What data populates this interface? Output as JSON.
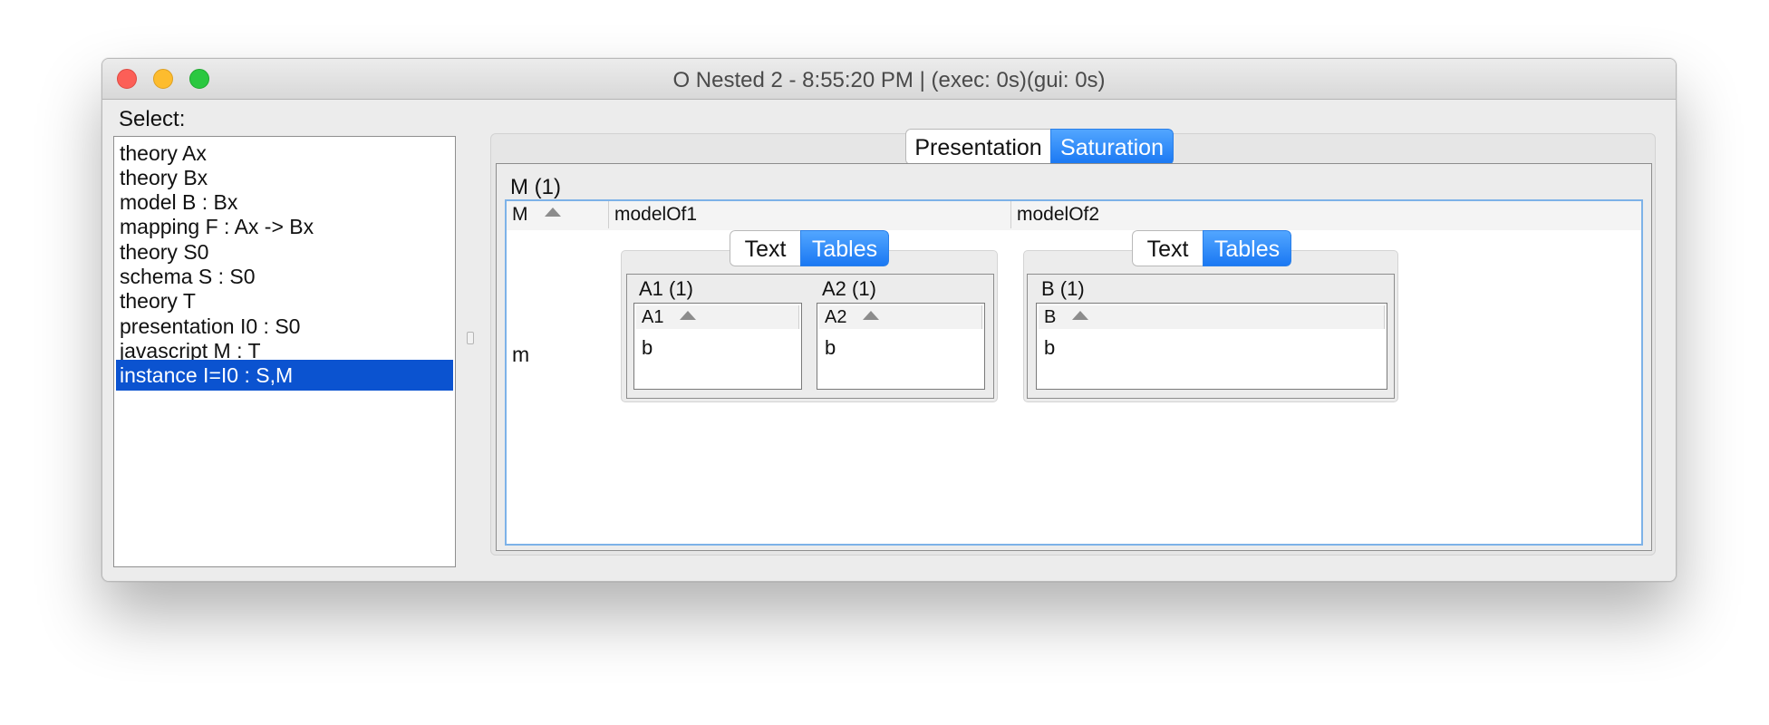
{
  "window": {
    "title": "O Nested 2 - 8:55:20 PM | (exec: 0s)(gui: 0s)"
  },
  "sidebar": {
    "label": "Select:",
    "items": [
      {
        "label": "theory Ax"
      },
      {
        "label": "theory Bx"
      },
      {
        "label": "model B : Bx"
      },
      {
        "label": "mapping F : Ax -> Bx"
      },
      {
        "label": "theory S0"
      },
      {
        "label": "schema S : S0"
      },
      {
        "label": "theory T"
      },
      {
        "label": "presentation I0 : S0"
      },
      {
        "label": "javascript M : T"
      },
      {
        "label": "instance I=I0 : S,M"
      }
    ],
    "selected": "instance I=I0 : S,M"
  },
  "view_tabs": {
    "presentation": "Presentation",
    "saturation": "Saturation",
    "active": "Saturation"
  },
  "model_table": {
    "title": "M (1)",
    "columns": [
      "M",
      "modelOf1",
      "modelOf2"
    ],
    "sorted_column": "M",
    "row_label": "m",
    "cells": [
      {
        "tabs": {
          "text": "Text",
          "tables": "Tables",
          "active": "Tables"
        },
        "tables": [
          {
            "title": "A1 (1)",
            "column": "A1",
            "rows": [
              "b"
            ]
          },
          {
            "title": "A2 (1)",
            "column": "A2",
            "rows": [
              "b"
            ]
          }
        ]
      },
      {
        "tabs": {
          "text": "Text",
          "tables": "Tables",
          "active": "Tables"
        },
        "tables": [
          {
            "title": "B (1)",
            "column": "B",
            "rows": [
              "b"
            ]
          }
        ]
      }
    ]
  },
  "colors": {
    "selection": "#0b53d0",
    "segment_active": "#1a78f3",
    "focus_border": "#7db2e8",
    "close": "#fc5f57",
    "minimize": "#fdbc2e",
    "maximize": "#2ac840"
  }
}
